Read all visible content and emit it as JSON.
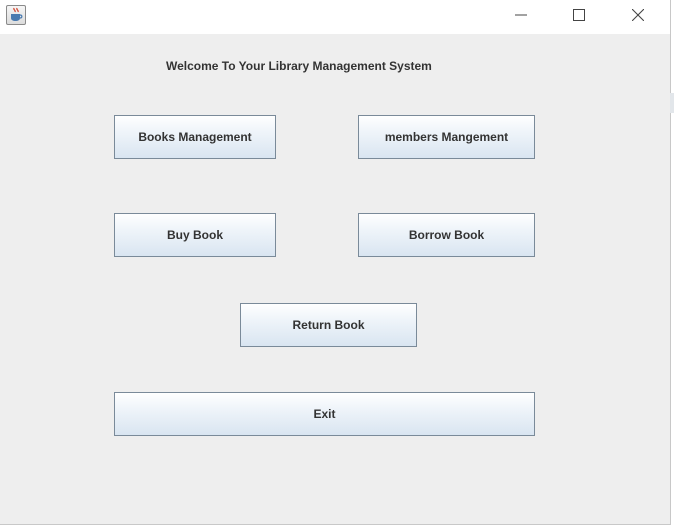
{
  "window": {
    "controls": {
      "minimize_icon": "minimize-icon",
      "maximize_icon": "maximize-icon",
      "close_icon": "close-icon"
    },
    "app_icon": "java-coffee-cup-icon"
  },
  "main": {
    "welcome_text": "Welcome To Your Library Management System",
    "buttons": {
      "books_management": "Books Management",
      "members_management": "members Mangement",
      "buy_book": "Buy Book",
      "borrow_book": "Borrow Book",
      "return_book": "Return Book",
      "exit": "Exit"
    }
  },
  "colors": {
    "window_bg": "#eeeeee",
    "titlebar_bg": "#ffffff",
    "button_border": "#7a8a99",
    "button_gradient_bottom": "#d9e5f1",
    "text": "#333333"
  }
}
